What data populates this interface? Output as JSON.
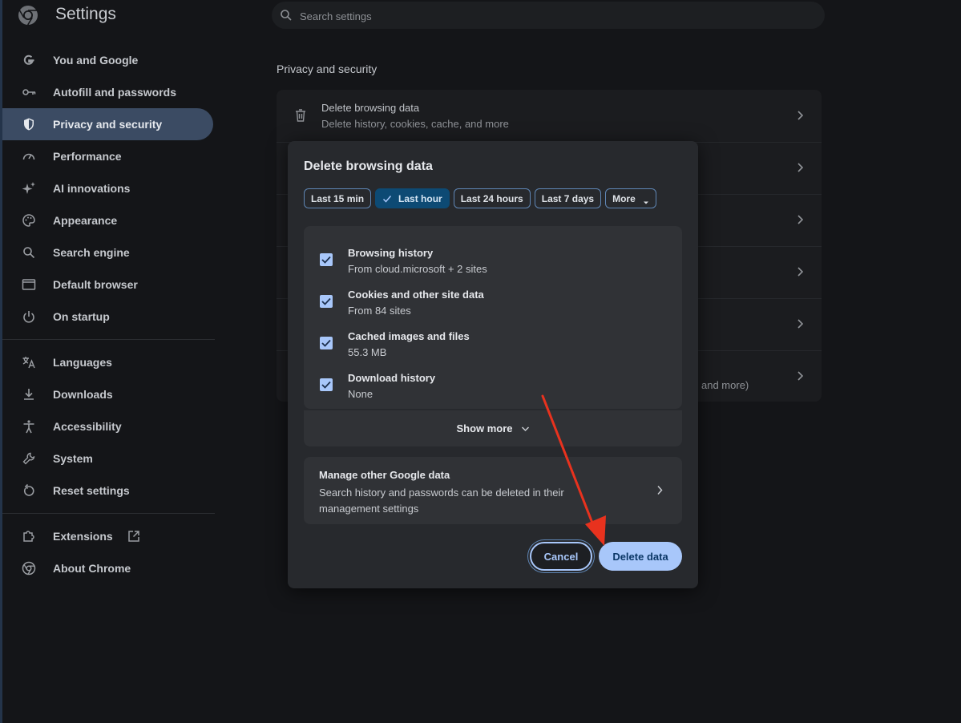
{
  "header": {
    "title": "Settings"
  },
  "search": {
    "placeholder": "Search settings"
  },
  "sidebar": {
    "items": [
      {
        "label": "You and Google",
        "icon": "google-icon"
      },
      {
        "label": "Autofill and passwords",
        "icon": "key-icon"
      },
      {
        "label": "Privacy and security",
        "icon": "shield-icon",
        "active": true
      },
      {
        "label": "Performance",
        "icon": "speedometer-icon"
      },
      {
        "label": "AI innovations",
        "icon": "sparkle-icon"
      },
      {
        "label": "Appearance",
        "icon": "palette-icon"
      },
      {
        "label": "Search engine",
        "icon": "search-icon"
      },
      {
        "label": "Default browser",
        "icon": "browser-window-icon"
      },
      {
        "label": "On startup",
        "icon": "power-icon"
      },
      {
        "label": "Languages",
        "icon": "translate-icon"
      },
      {
        "label": "Downloads",
        "icon": "download-icon"
      },
      {
        "label": "Accessibility",
        "icon": "accessibility-icon"
      },
      {
        "label": "System",
        "icon": "wrench-icon"
      },
      {
        "label": "Reset settings",
        "icon": "reset-icon"
      },
      {
        "label": "Extensions",
        "icon": "puzzle-icon"
      },
      {
        "label": "About Chrome",
        "icon": "chrome-icon"
      }
    ]
  },
  "main": {
    "section_title": "Privacy and security",
    "rows": [
      {
        "title": "Delete browsing data",
        "subtitle": "Delete history, cookies, cache, and more"
      }
    ],
    "partial_text": "and more)"
  },
  "dialog": {
    "title": "Delete browsing data",
    "time_ranges": [
      "Last 15 min",
      "Last hour",
      "Last 24 hours",
      "Last 7 days",
      "More"
    ],
    "selected_range": "Last hour",
    "options": [
      {
        "title": "Browsing history",
        "subtitle": "From cloud.microsoft + 2 sites",
        "checked": true
      },
      {
        "title": "Cookies and other site data",
        "subtitle": "From 84 sites",
        "checked": true
      },
      {
        "title": "Cached images and files",
        "subtitle": "55.3 MB",
        "checked": true
      },
      {
        "title": "Download history",
        "subtitle": "None",
        "checked": true
      }
    ],
    "show_more": "Show more",
    "manage": {
      "title": "Manage other Google data",
      "subtitle": "Search history and passwords can be deleted in their management settings"
    },
    "cancel_label": "Cancel",
    "delete_label": "Delete data"
  },
  "colors": {
    "accent": "#a8c7fa",
    "selected_chip": "#0d4a74",
    "annotation_arrow": "#e8321e"
  }
}
